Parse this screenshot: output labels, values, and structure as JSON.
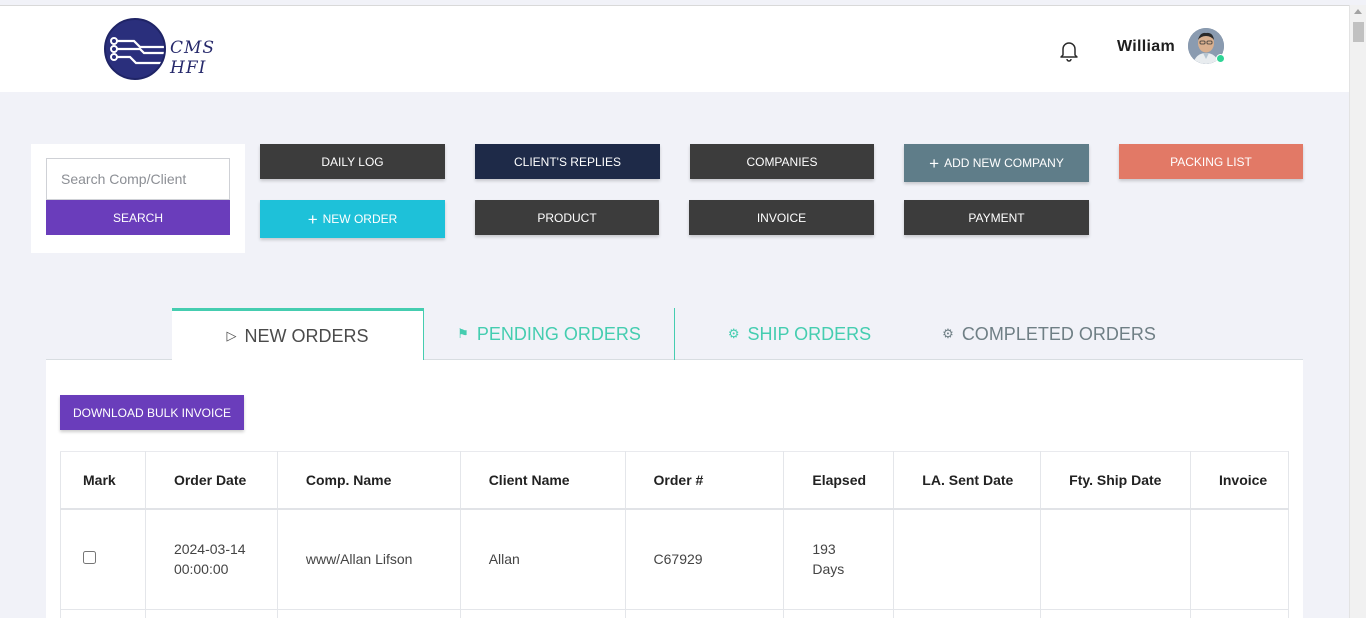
{
  "header": {
    "logo_text": "CMS HFI",
    "user_name": "William"
  },
  "search": {
    "placeholder": "Search Comp/Client",
    "button_label": "SEARCH"
  },
  "quick_buttons": {
    "daily_log": "DAILY LOG",
    "clients_replies": "CLIENT'S REPLIES",
    "companies": "COMPANIES",
    "add_new_company": "ADD NEW COMPANY",
    "packing_list": "PACKING LIST",
    "new_order": "NEW ORDER",
    "product": "PRODUCT",
    "invoice": "INVOICE",
    "payment": "PAYMENT"
  },
  "colors": {
    "accent_purple": "#6a3dbb",
    "cyan": "#1ec1d9",
    "navy": "#1e2a48",
    "slate": "#5f7d89",
    "salmon": "#e27966",
    "dark": "#3c3c3c",
    "teal": "#45cdb0"
  },
  "tabs": [
    {
      "label": "NEW ORDERS",
      "icon": "play-icon",
      "glyph": "▷"
    },
    {
      "label": "PENDING ORDERS",
      "icon": "flag-icon",
      "glyph": "⚑"
    },
    {
      "label": "SHIP ORDERS",
      "icon": "gear-icon",
      "glyph": "⚙"
    },
    {
      "label": "COMPLETED ORDERS",
      "icon": "gear-icon",
      "glyph": "⚙"
    }
  ],
  "main": {
    "bulk_invoice_label": "DOWNLOAD BULK INVOICE"
  },
  "table": {
    "columns": [
      "Mark",
      "Order Date",
      "Comp. Name",
      "Client Name",
      "Order #",
      "Elapsed",
      "LA. Sent Date",
      "Fty. Ship Date",
      "Invoice"
    ],
    "rows": [
      {
        "order_date_1": "2024-03-14",
        "order_date_2": "00:00:00",
        "comp_name": "www/Allan Lifson",
        "client_name": "Allan",
        "order_no": "C67929",
        "elapsed_1": "193",
        "elapsed_2": "Days",
        "la_sent_date": "",
        "fty_ship_date": "",
        "invoice": ""
      }
    ]
  }
}
